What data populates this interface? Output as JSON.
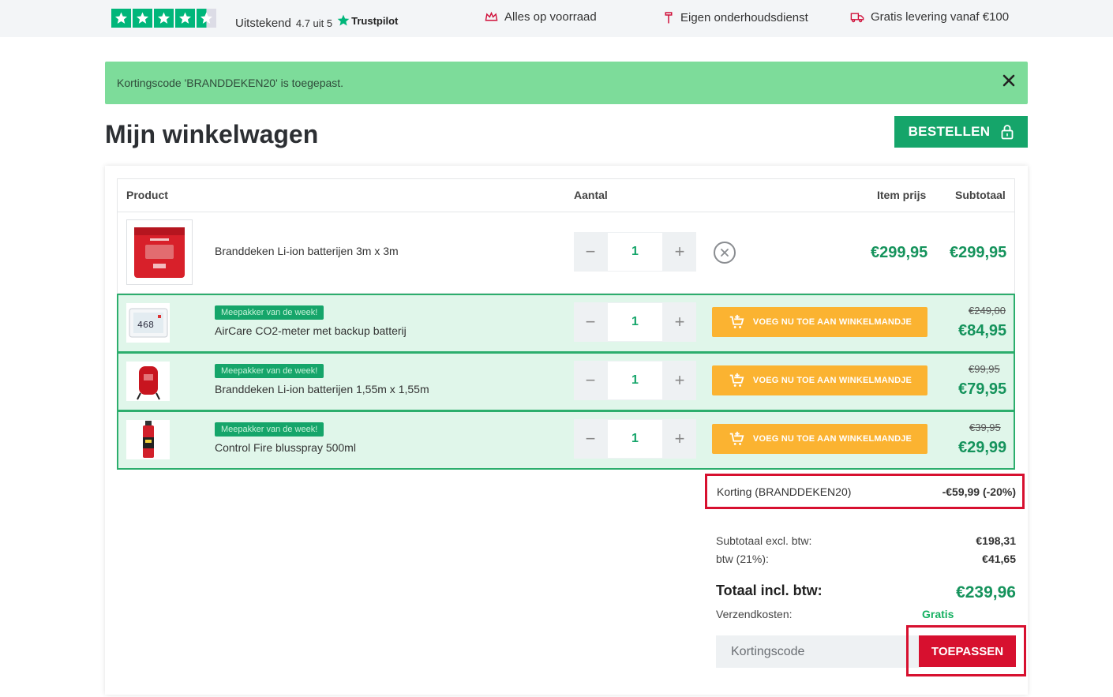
{
  "topbar": {
    "rating_word": "Uitstekend",
    "rating_score": "4.7 uit 5",
    "trustpilot": "Trustpilot",
    "usps": [
      "Alles op voorraad",
      "Eigen onderhoudsdienst",
      "Gratis levering vanaf €100"
    ]
  },
  "notice": {
    "text": "Kortingscode 'BRANDDEKEN20' is toegepast."
  },
  "page": {
    "title": "Mijn winkelwagen",
    "order_button": "BESTELLEN"
  },
  "table": {
    "headers": {
      "product": "Product",
      "qty": "Aantal",
      "item_price": "Item prijs",
      "subtotal": "Subtotaal"
    },
    "main_item": {
      "name": "Branddeken Li-ion batterijen 3m x 3m",
      "qty": "1",
      "item_price": "€299,95",
      "subtotal": "€299,95"
    },
    "upsells": [
      {
        "badge": "Meepakker van de week!",
        "name": "AirCare CO2-meter met backup batterij",
        "qty": "1",
        "button": "VOEG NU TOE AAN WINKELMANDJE",
        "old_price": "€249,00",
        "price": "€84,95"
      },
      {
        "badge": "Meepakker van de week!",
        "name": "Branddeken Li-ion batterijen 1,55m x 1,55m",
        "qty": "1",
        "button": "VOEG NU TOE AAN WINKELMANDJE",
        "old_price": "€99,95",
        "price": "€79,95"
      },
      {
        "badge": "Meepakker van de week!",
        "name": "Control Fire blusspray 500ml",
        "qty": "1",
        "button": "VOEG NU TOE AAN WINKELMANDJE",
        "old_price": "€39,95",
        "price": "€29,99"
      }
    ]
  },
  "summary": {
    "discount_label": "Korting (BRANDDEKEN20)",
    "discount_value": "-€59,99 (-20%)",
    "subtotal_label": "Subtotaal excl. btw:",
    "subtotal_value": "€198,31",
    "vat_label": "btw (21%):",
    "vat_value": "€41,65",
    "total_label": "Totaal incl. btw:",
    "total_value": "€239,96",
    "shipping_label": "Verzendkosten:",
    "shipping_value": "Gratis"
  },
  "coupon": {
    "placeholder": "Kortingscode",
    "apply_label": "TOEPASSEN"
  },
  "colors": {
    "green": "#15a56a",
    "red": "#d7102f",
    "orange": "#fbb331",
    "notice": "#7ddc9a"
  }
}
